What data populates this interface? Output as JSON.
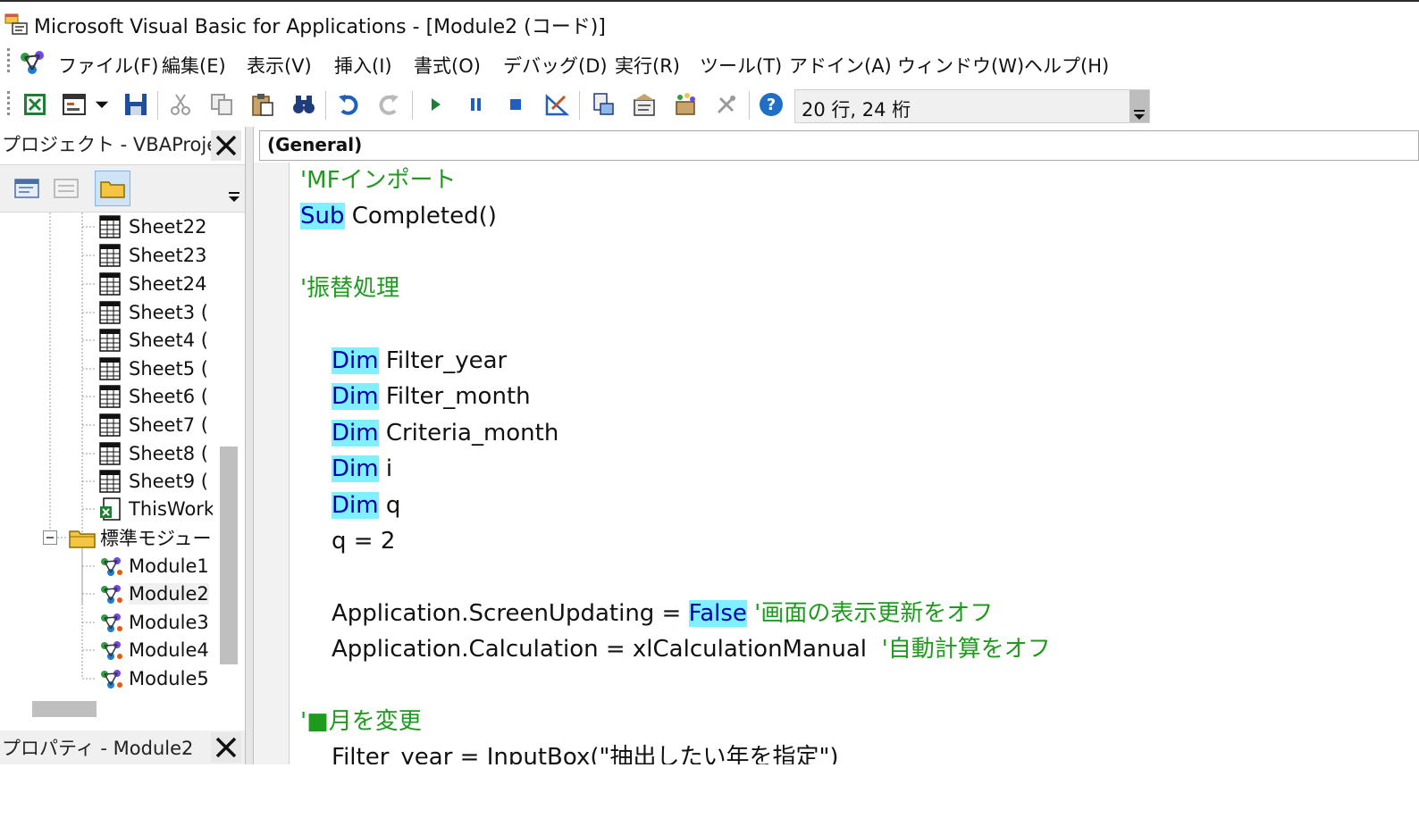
{
  "window": {
    "title": "Microsoft Visual Basic for Applications - [Module2 (コード)]"
  },
  "menu": [
    {
      "label": "ファイル(F)"
    },
    {
      "label": "編集(E)"
    },
    {
      "label": "表示(V)"
    },
    {
      "label": "挿入(I)"
    },
    {
      "label": "書式(O)"
    },
    {
      "label": "デバッグ(D)"
    },
    {
      "label": "実行(R)"
    },
    {
      "label": "ツール(T)"
    },
    {
      "label": "アドイン(A)"
    },
    {
      "label": "ウィンドウ(W)"
    },
    {
      "label": "ヘルプ(H)"
    }
  ],
  "toolbar": {
    "position_text": "20 行, 24 桁"
  },
  "project_panel": {
    "title": "プロジェクト - VBAProject",
    "tree": [
      {
        "label": "Sheet22",
        "type": "sheet"
      },
      {
        "label": "Sheet23",
        "type": "sheet"
      },
      {
        "label": "Sheet24",
        "type": "sheet"
      },
      {
        "label": "Sheet3 (",
        "type": "sheet"
      },
      {
        "label": "Sheet4 (",
        "type": "sheet"
      },
      {
        "label": "Sheet5 (",
        "type": "sheet"
      },
      {
        "label": "Sheet6 (",
        "type": "sheet"
      },
      {
        "label": "Sheet7 (",
        "type": "sheet"
      },
      {
        "label": "Sheet8 (",
        "type": "sheet"
      },
      {
        "label": "Sheet9 (",
        "type": "sheet"
      },
      {
        "label": "ThisWork",
        "type": "workbook"
      },
      {
        "label": "標準モジュー",
        "type": "folder"
      },
      {
        "label": "Module1",
        "type": "module"
      },
      {
        "label": "Module2",
        "type": "module",
        "selected": true
      },
      {
        "label": "Module3",
        "type": "module"
      },
      {
        "label": "Module4",
        "type": "module"
      },
      {
        "label": "Module5",
        "type": "module"
      }
    ]
  },
  "properties_panel": {
    "title": "プロパティ - Module2"
  },
  "code_window": {
    "object_combo": "(General)",
    "lines": [
      {
        "indent": 0,
        "parts": [
          {
            "t": "'MFインポート",
            "s": "cm"
          }
        ]
      },
      {
        "indent": 0,
        "parts": [
          {
            "t": "Sub",
            "s": "kw"
          },
          {
            "t": " Completed()",
            "s": ""
          }
        ]
      },
      {
        "indent": 0,
        "parts": []
      },
      {
        "indent": 0,
        "parts": [
          {
            "t": "'振替処理",
            "s": "cm"
          }
        ]
      },
      {
        "indent": 0,
        "parts": []
      },
      {
        "indent": 1,
        "parts": [
          {
            "t": "Dim",
            "s": "kw"
          },
          {
            "t": " Filter_year",
            "s": ""
          }
        ]
      },
      {
        "indent": 1,
        "parts": [
          {
            "t": "Dim",
            "s": "kw"
          },
          {
            "t": " Filter_month",
            "s": ""
          }
        ]
      },
      {
        "indent": 1,
        "parts": [
          {
            "t": "Dim",
            "s": "kw"
          },
          {
            "t": " Criteria_month",
            "s": ""
          }
        ]
      },
      {
        "indent": 1,
        "parts": [
          {
            "t": "Dim",
            "s": "kw"
          },
          {
            "t": " i",
            "s": ""
          }
        ]
      },
      {
        "indent": 1,
        "parts": [
          {
            "t": "Dim",
            "s": "kw"
          },
          {
            "t": " q",
            "s": ""
          }
        ]
      },
      {
        "indent": 1,
        "parts": [
          {
            "t": "q = 2",
            "s": ""
          }
        ]
      },
      {
        "indent": 0,
        "parts": []
      },
      {
        "indent": 1,
        "parts": [
          {
            "t": "Application.ScreenUpdating = ",
            "s": ""
          },
          {
            "t": "False",
            "s": "kw"
          },
          {
            "t": " '画面の表示更新をオフ",
            "s": "cm"
          }
        ]
      },
      {
        "indent": 1,
        "parts": [
          {
            "t": "Application.Calculation = xlCalculationManual  ",
            "s": ""
          },
          {
            "t": "'自動計算をオフ",
            "s": "cm"
          }
        ]
      },
      {
        "indent": 0,
        "parts": []
      },
      {
        "indent": 0,
        "parts": [
          {
            "t": "'■月を変更",
            "s": "cm"
          }
        ]
      },
      {
        "indent": 1,
        "parts": [
          {
            "t": "Filter_year = InputBox(\"抽出したい年を指定\")",
            "s": ""
          }
        ]
      }
    ]
  },
  "colors": {
    "keyword_highlight": "#7ff0ff",
    "keyword_text": "#0000a8",
    "comment": "#1f9a1f"
  }
}
